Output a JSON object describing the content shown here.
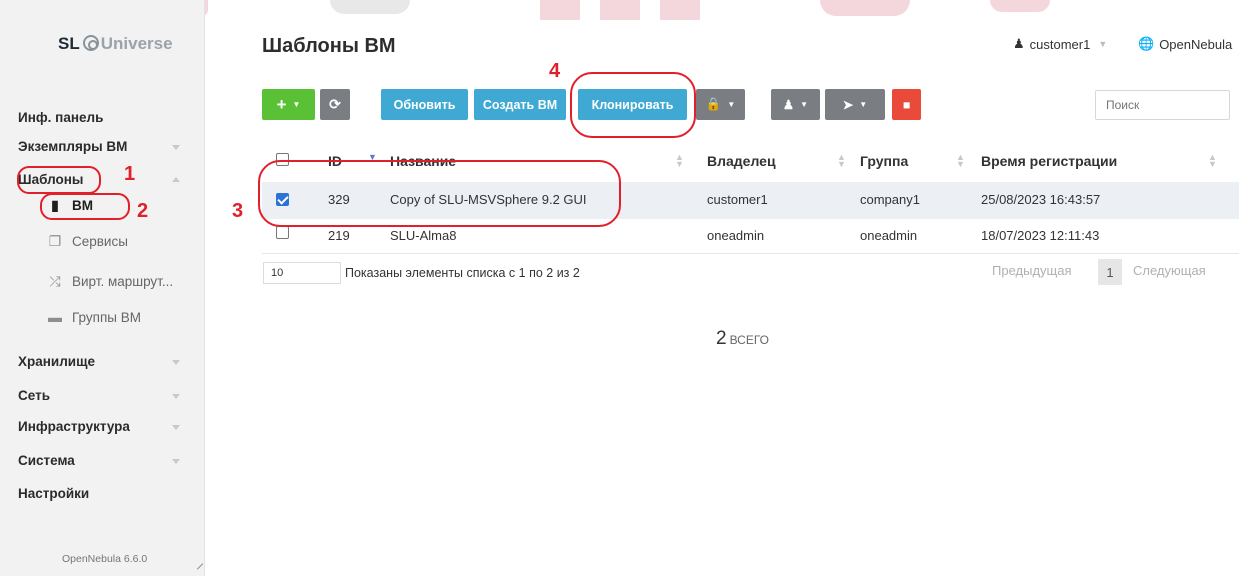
{
  "sidebar": {
    "logo_prefix": "SL",
    "logo_suffix": "Universe",
    "items": [
      {
        "label": "Инф. панель"
      },
      {
        "label": "Экземпляры ВМ"
      },
      {
        "label": "Шаблоны"
      },
      {
        "label": "Хранилище"
      },
      {
        "label": "Сеть"
      },
      {
        "label": "Инфраструктура"
      },
      {
        "label": "Система"
      },
      {
        "label": "Настройки"
      }
    ],
    "subitems": [
      {
        "label": "ВМ",
        "icon": "file-icon"
      },
      {
        "label": "Сервисы",
        "icon": "copy-icon"
      },
      {
        "label": "Вирт. маршрут...",
        "icon": "shuffle-icon"
      },
      {
        "label": "Группы ВМ",
        "icon": "folder-icon"
      }
    ],
    "version": "OpenNebula 6.6.0"
  },
  "header": {
    "title": "Шаблоны ВМ",
    "user": "customer1",
    "zone": "OpenNebula"
  },
  "toolbar": {
    "refresh_label": "Обновить",
    "create_vm_label": "Создать ВМ",
    "clone_label": "Клонировать",
    "search_placeholder": "Поиск"
  },
  "table": {
    "columns": [
      "ID",
      "Название",
      "Владелец",
      "Группа",
      "Время регистрации"
    ],
    "rows": [
      {
        "id": "329",
        "name": "Copy of SLU-MSVSphere 9.2 GUI",
        "owner": "customer1",
        "group": "company1",
        "time": "25/08/2023 16:43:57",
        "checked": true
      },
      {
        "id": "219",
        "name": "SLU-Alma8",
        "owner": "oneadmin",
        "group": "oneadmin",
        "time": "18/07/2023 12:11:43",
        "checked": false
      }
    ],
    "page_size": "10",
    "info": "Показаны элементы списка с 1 по 2 из 2",
    "prev_label": "Предыдущая",
    "page": "1",
    "next_label": "Следующая",
    "total_count": "2",
    "total_label": "всего"
  },
  "annotations": [
    "1",
    "2",
    "3",
    "4"
  ],
  "colors": {
    "green": "#5ac136",
    "blue": "#3fa9d3",
    "gray": "#7a7e82",
    "red": "#ea4a3a",
    "annotation": "#e0202a"
  }
}
